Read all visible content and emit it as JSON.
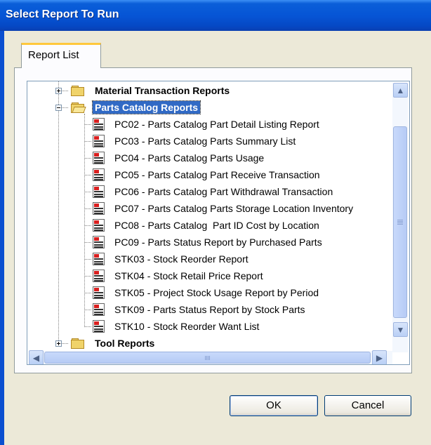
{
  "window": {
    "title": "Select Report To Run"
  },
  "tabs": [
    {
      "label": "Report List"
    }
  ],
  "tree": {
    "categories": [
      {
        "label": "Material Transaction Reports",
        "expanded": false
      },
      {
        "label": "Parts Catalog Reports",
        "expanded": true,
        "selected": true
      },
      {
        "label": "Tool Reports",
        "expanded": false
      }
    ],
    "reports": [
      "PC02 - Parts Catalog Part Detail Listing Report",
      "PC03 - Parts Catalog Parts Summary List",
      "PC04 - Parts Catalog Parts Usage",
      "PC05 - Parts Catalog Part Receive Transaction",
      "PC06 - Parts Catalog Part Withdrawal Transaction",
      "PC07 - Parts Catalog Parts Storage Location Inventory",
      "PC08 - Parts Catalog  Part ID Cost by Location",
      "PC09 - Parts Status Report by Purchased Parts",
      "STK03 - Stock Reorder Report",
      "STK04 - Stock Retail Price Report",
      "STK05 - Project Stock Usage Report by Period",
      "STK09 - Parts Status Report by Stock Parts",
      "STK10 - Stock Reorder Want List"
    ]
  },
  "buttons": {
    "ok": "OK",
    "cancel": "Cancel"
  },
  "colors": {
    "title_bar": "#0655d6",
    "selection": "#316ac5",
    "tab_accent": "#ffc83c"
  }
}
